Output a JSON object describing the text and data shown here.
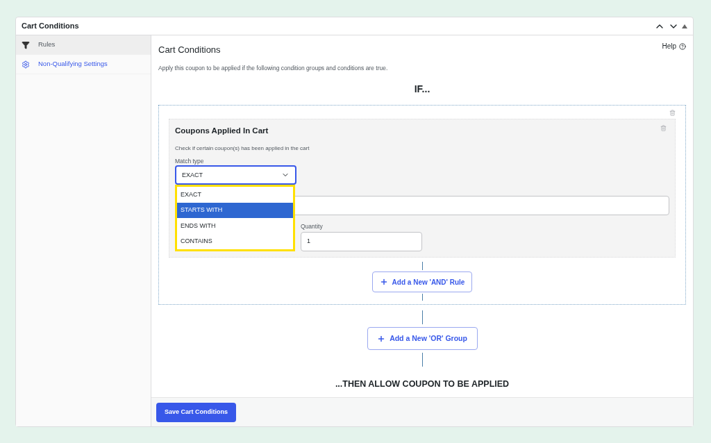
{
  "panel": {
    "title": "Cart Conditions"
  },
  "sidebar": {
    "items": [
      {
        "label": "Rules",
        "kind": "filter",
        "selected": true
      },
      {
        "label": "Non-Qualifying Settings",
        "kind": "settings",
        "selected": false
      }
    ]
  },
  "main": {
    "title": "Cart Conditions",
    "help": "Help",
    "description": "Apply this coupon to be applied if the following condition groups and conditions are true.",
    "if_label": "IF...",
    "group": {
      "condition": {
        "title": "Coupons Applied In Cart",
        "description": "Check if certain coupon(s) has been applied in the cart",
        "match_type": {
          "label": "Match type",
          "value": "EXACT",
          "expanded": true,
          "options": [
            {
              "label": "EXACT",
              "highlighted": false
            },
            {
              "label": "STARTS WITH",
              "highlighted": true
            },
            {
              "label": "ENDS WITH",
              "highlighted": false
            },
            {
              "label": "CONTAINS",
              "highlighted": false
            }
          ]
        },
        "quantity": {
          "label": "Quantity",
          "value": "1"
        }
      },
      "add_and": "Add a New 'AND' Rule"
    },
    "add_or": "Add a New 'OR' Group",
    "then_label": "...THEN ALLOW COUPON TO BE APPLIED"
  },
  "footer": {
    "save": "Save Cart Conditions"
  }
}
